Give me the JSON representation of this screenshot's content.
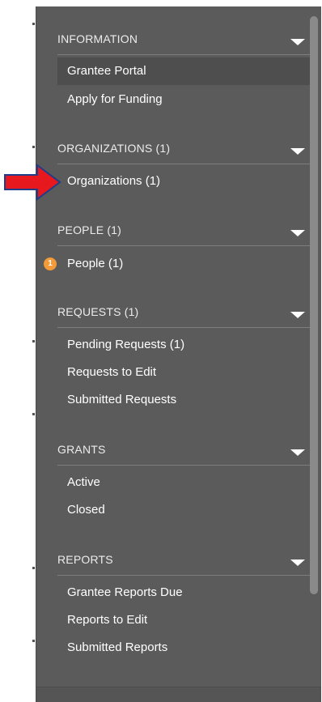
{
  "sections": [
    {
      "title": "INFORMATION",
      "items": [
        "Grantee Portal",
        "Apply for Funding"
      ]
    },
    {
      "title": "ORGANIZATIONS (1)",
      "items": [
        "Organizations  (1)"
      ]
    },
    {
      "title": "PEOPLE (1)",
      "items": [
        "People  (1)"
      ]
    },
    {
      "title": "REQUESTS (1)",
      "items": [
        "Pending Requests  (1)",
        "Requests to Edit",
        "Submitted Requests"
      ]
    },
    {
      "title": "GRANTS",
      "items": [
        "Active",
        "Closed"
      ]
    },
    {
      "title": "REPORTS",
      "items": [
        "Grantee Reports Due",
        "Reports to Edit",
        "Submitted Reports"
      ]
    }
  ],
  "badges": {
    "people": "1"
  },
  "colors": {
    "sidebar_bg": "#5b5b5b",
    "active_item_bg": "#4e4e4e",
    "badge": "#f29b38",
    "arrow": "#e8191e",
    "arrow_outline": "#1f3d8a"
  },
  "icons": {
    "caret": "caret-down-icon",
    "pointer": "red-arrow-icon"
  }
}
